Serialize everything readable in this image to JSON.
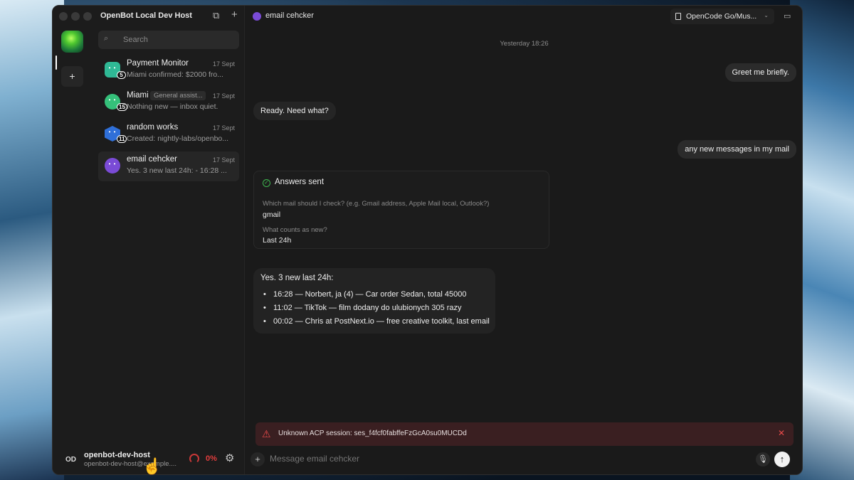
{
  "app": {
    "title": "OpenBot Local Dev Host"
  },
  "sidebar": {
    "search_placeholder": "Search",
    "chats": [
      {
        "name": "Payment Monitor",
        "tag": "",
        "date": "17 Sept",
        "preview": "Miami confirmed: $2000 fro...",
        "badge": "5",
        "avatar_color": "#2fb895"
      },
      {
        "name": "Miami",
        "tag": "General assist...",
        "date": "17 Sept",
        "preview": "Nothing new — inbox quiet.",
        "badge": "15",
        "avatar_color": "#35c07a"
      },
      {
        "name": "random works",
        "tag": "",
        "date": "17 Sept",
        "preview": "Created: nightly-labs/openbo...",
        "badge": "11",
        "avatar_color": "#2f6fd8"
      },
      {
        "name": "email cehcker",
        "tag": "",
        "date": "17 Sept",
        "preview": "Yes. 3 new last 24h: - 16:28 ...",
        "badge": "",
        "avatar_color": "#7a4bd6"
      }
    ],
    "footer": {
      "initials": "OD",
      "name": "openbot-dev-host",
      "email": "openbot-dev-host@example....",
      "usage": "0%"
    }
  },
  "header": {
    "title": "email cehcker",
    "model": "OpenCode Go/Mus..."
  },
  "conversation": {
    "timestamp": "Yesterday 18:26",
    "msg1_user": "Greet me briefly.",
    "msg2_bot": "Ready. Need what?",
    "msg3_user": "any new messages in my mail",
    "answers": {
      "title": "Answers sent",
      "q1": "Which mail should I check? (e.g. Gmail address, Apple Mail local, Outlook?)",
      "a1": "gmail",
      "q2": "What counts as new?",
      "a2": "Last 24h"
    },
    "result": {
      "head": "Yes. 3 new last 24h:",
      "items": [
        "16:28 — Norbert, ja (4) — Car order Sedan, total 45000",
        "11:02 — TikTok — film dodany do ulubionych 305 razy",
        "00:02 — Chris at PostNext.io — free creative toolkit, last email"
      ]
    }
  },
  "error": {
    "text": "Unknown ACP session: ses_f4fcf0fabffeFzGcA0su0MUCDd"
  },
  "composer": {
    "placeholder": "Message email cehcker"
  }
}
